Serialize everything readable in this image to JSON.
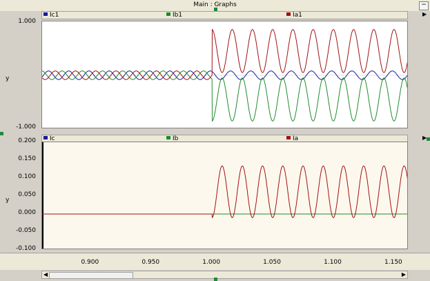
{
  "window": {
    "title": "Main : Graphs",
    "min_label": "−"
  },
  "icons": {
    "scroll_left": "arrow-left-icon",
    "scroll_right": "arrow-right-icon",
    "panel_menu": "arrow-right-icon"
  },
  "colors": {
    "series_red": "#a01010",
    "series_green": "#1e8a2a",
    "series_blue": "#1a1a9a",
    "plot_bg_top": "#ffffff",
    "plot_bg_bottom": "#fdf8ee"
  },
  "panel1": {
    "legend": [
      {
        "name": "Ic1",
        "color": "#1a1a9a"
      },
      {
        "name": "Ib1",
        "color": "#1e8a2a"
      },
      {
        "name": "Ia1",
        "color": "#a01010"
      }
    ],
    "ylabel": "y",
    "yticks": [
      "1.000",
      "-1.000"
    ]
  },
  "panel2": {
    "legend": [
      {
        "name": "Ic",
        "color": "#1a1a9a"
      },
      {
        "name": "Ib",
        "color": "#1e8a2a"
      },
      {
        "name": "Ia",
        "color": "#a01010"
      }
    ],
    "ylabel": "y",
    "yticks": [
      "0.200",
      "0.150",
      "0.100",
      "0.050",
      "0.000",
      "-0.050",
      "-0.100"
    ]
  },
  "xaxis": {
    "ticks": [
      "0.900",
      "0.950",
      "1.000",
      "1.050",
      "1.100",
      "1.150"
    ]
  },
  "chart_data": [
    {
      "type": "line",
      "xlim": [
        0.86,
        1.162
      ],
      "ylim": [
        -1.0,
        1.0
      ],
      "ylabel": "y",
      "series": [
        {
          "name": "Ic1",
          "description_amplitude_before": 0.08,
          "amplitude_after": 0.08,
          "offset": 0.0
        },
        {
          "name": "Ib1",
          "amplitude_before": 0.08,
          "amplitude_after": 0.4,
          "offset": -0.45
        },
        {
          "name": "Ia1",
          "amplitude_before": 0.08,
          "amplitude_after": 0.4,
          "offset": 0.45
        }
      ],
      "step_time": 1.0,
      "frequency_hz": 60
    },
    {
      "type": "line",
      "xlim": [
        0.86,
        1.162
      ],
      "ylim": [
        -0.1,
        0.2
      ],
      "ylabel": "y",
      "series": [
        {
          "name": "Ic",
          "amplitude": 0.0,
          "offset": 0.0
        },
        {
          "name": "Ib",
          "amplitude": 0.0,
          "offset": 0.0
        },
        {
          "name": "Ia",
          "amplitude_after": 0.072,
          "offset_after": 0.062
        }
      ],
      "step_time": 1.0,
      "frequency_hz": 60
    }
  ]
}
